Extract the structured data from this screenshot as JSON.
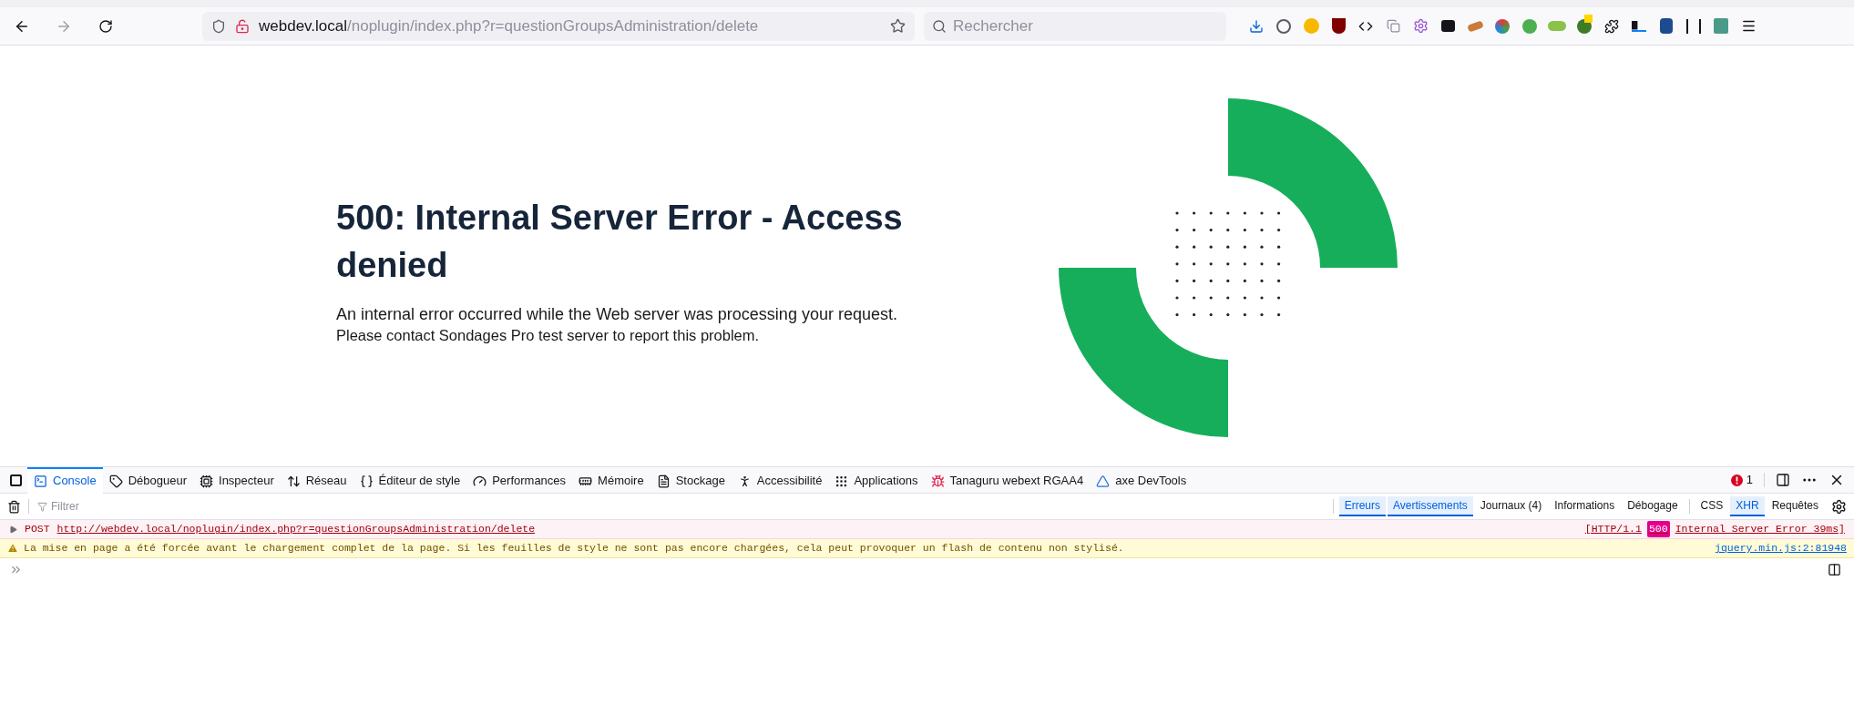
{
  "browser": {
    "back_enabled": true,
    "forward_enabled": false,
    "url_host": "webdev.local",
    "url_path": "/noplugin/index.php?r=questionGroupsAdministration/delete",
    "search_placeholder": "Rechercher"
  },
  "page": {
    "heading": "500: Internal Server Error - Access denied",
    "paragraphs": [
      "An internal error occurred while the Web server was processing your request.",
      "Please contact Sondages Pro test server to report this problem."
    ]
  },
  "devtools": {
    "tabs": [
      {
        "label": "Console",
        "selected": true
      },
      {
        "label": "Débogueur",
        "selected": false
      },
      {
        "label": "Inspecteur",
        "selected": false
      },
      {
        "label": "Réseau",
        "selected": false
      },
      {
        "label": "Éditeur de style",
        "selected": false
      },
      {
        "label": "Performances",
        "selected": false
      },
      {
        "label": "Mémoire",
        "selected": false
      },
      {
        "label": "Stockage",
        "selected": false
      },
      {
        "label": "Accessibilité",
        "selected": false
      },
      {
        "label": "Applications",
        "selected": false
      },
      {
        "label": "Tanaguru webext RGAA4",
        "selected": false
      },
      {
        "label": "axe DevTools",
        "selected": false
      }
    ],
    "error_count": "1",
    "filter_placeholder": "Filtrer",
    "log_levels": [
      {
        "label": "Erreurs",
        "selected": true
      },
      {
        "label": "Avertissements",
        "selected": true
      },
      {
        "label": "Journaux (4)",
        "selected": false
      },
      {
        "label": "Informations",
        "selected": false
      },
      {
        "label": "Débogage",
        "selected": false
      }
    ],
    "request_filters": [
      {
        "label": "CSS",
        "selected": false
      },
      {
        "label": "XHR",
        "selected": true
      },
      {
        "label": "Requêtes",
        "selected": false
      }
    ],
    "messages": [
      {
        "kind": "error",
        "method": "POST",
        "url": "http://webdev.local/noplugin/index.php?r=questionGroupsAdministration/delete",
        "status_prefix": "[HTTP/1.1",
        "status_code": "500",
        "status_suffix": "Internal Server Error 39ms]"
      },
      {
        "kind": "warning",
        "text": "La mise en page a été forcée avant le chargement complet de la page. Si les feuilles de style ne sont pas encore chargées, cela peut provoquer un flash de contenu non stylisé.",
        "source": "jquery.min.js:2:81948"
      }
    ]
  }
}
